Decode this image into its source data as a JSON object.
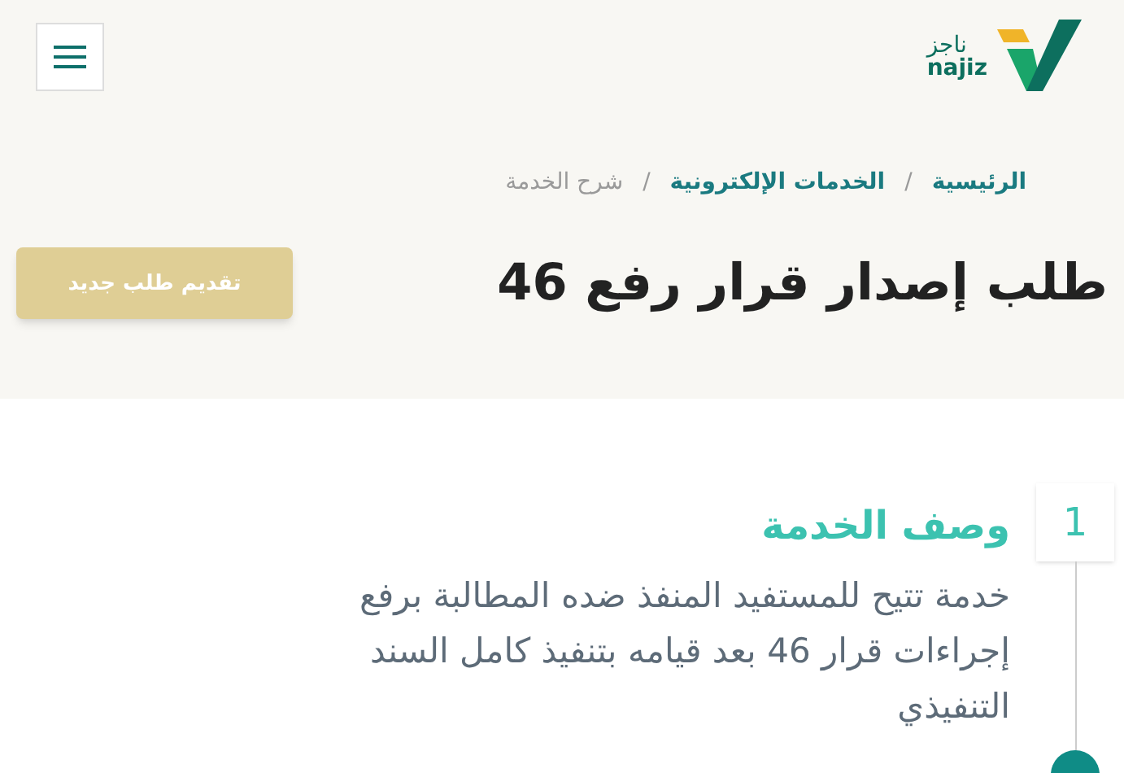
{
  "header": {
    "logo": {
      "arabic": "ناجز",
      "latin": "najiz"
    }
  },
  "breadcrumb": [
    {
      "label": "الرئيسية",
      "kind": "link"
    },
    {
      "label": "الخدمات الإلكترونية",
      "kind": "link"
    },
    {
      "label": "شرح الخدمة",
      "kind": "current"
    }
  ],
  "separator": "/",
  "title": "طلب إصدار قرار رفع 46",
  "new_request_button": "تقديم طلب جديد",
  "steps": [
    {
      "number": "1",
      "heading": "وصف الخدمة",
      "text": "خدمة تتيح للمستفيد المنفذ ضده المطالبة برفع إجراءات قرار 46 بعد قيامه بتنفيذ كامل السند التنفيذي"
    }
  ]
}
